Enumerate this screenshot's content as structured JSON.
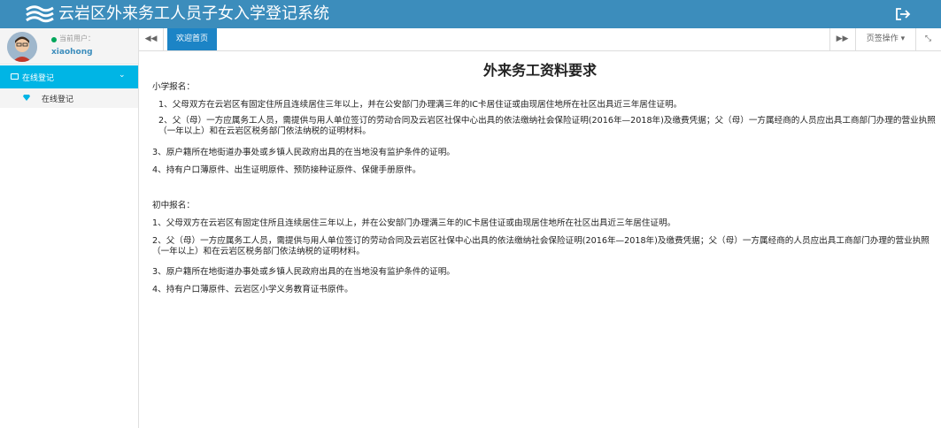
{
  "header": {
    "title": "云岩区外来务工人员子女入学登记系统",
    "logo_icon": "cloud-logo-icon",
    "logout_icon": "logout-icon",
    "background": "#3c8dbc"
  },
  "sidebar": {
    "user_label": "当前用户：",
    "username": "xiaohong",
    "menu": {
      "label": "在线登记",
      "icon": "id-card-icon",
      "accent": "#00b5e5",
      "items": [
        {
          "label": "在线登记",
          "icon": "diamond-icon"
        }
      ]
    }
  },
  "tabbar": {
    "tabs": [
      {
        "label": "欢迎首页",
        "active": true
      }
    ],
    "prev_icon": "◀◀",
    "next_icon": "▶▶",
    "ops_label": "页签操作",
    "ops_caret": "▾",
    "fullscreen_icon": "⤡"
  },
  "content": {
    "title": "外来务工资料要求",
    "primary": {
      "heading": "小学报名：",
      "items": [
        "1、父母双方在云岩区有固定住所且连续居住三年以上，并在公安部门办理满三年的IC卡居住证或由现居住地所在社区出具近三年居住证明。",
        "2、父（母）一方应属务工人员，需提供与用人单位签订的劳动合同及云岩区社保中心出具的依法缴纳社会保险证明(2016年—2018年)及缴费凭据；父（母）一方属经商的人员应出具工商部门办理的营业执照（一年以上）和在云岩区税务部门依法纳税的证明材料。",
        "3、原户籍所在地街道办事处或乡镇人民政府出具的在当地没有监护条件的证明。",
        "4、持有户口薄原件、出生证明原件、预防接种证原件、保健手册原件。"
      ]
    },
    "junior": {
      "heading": "初中报名：",
      "items": [
        "1、父母双方在云岩区有固定住所且连续居住三年以上，并在公安部门办理满三年的IC卡居住证或由现居住地所在社区出具近三年居住证明。",
        "2、父（母）一方应属务工人员，需提供与用人单位签订的劳动合同及云岩区社保中心出具的依法缴纳社会保险证明(2016年—2018年)及缴费凭据；父（母）一方属经商的人员应出具工商部门办理的营业执照（一年以上）和在云岩区税务部门依法纳税的证明材料。",
        "3、原户籍所在地街道办事处或乡镇人民政府出具的在当地没有监护条件的证明。",
        "4、持有户口薄原件、云岩区小学义务教育证书原件。"
      ]
    }
  }
}
